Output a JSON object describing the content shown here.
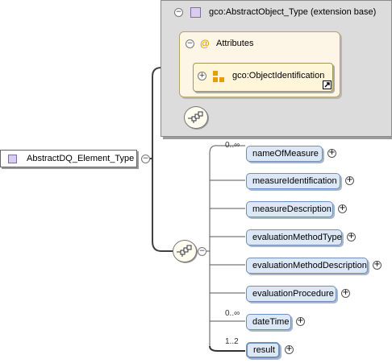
{
  "root": {
    "label": "AbstractDQ_Element_Type",
    "toggle": "−"
  },
  "extension": {
    "title": "gco:AbstractObject_Type (extension base)",
    "toggle": "−",
    "attributes": {
      "label": "Attributes",
      "toggle": "−",
      "group": {
        "label": "gco:ObjectIdentification",
        "toggle": "+"
      }
    }
  },
  "sequence": {
    "toggle": "−",
    "elements": [
      {
        "label": "nameOfMeasure",
        "cardinality": "0..∞"
      },
      {
        "label": "measureIdentification",
        "cardinality": ""
      },
      {
        "label": "measureDescription",
        "cardinality": ""
      },
      {
        "label": "evaluationMethodType",
        "cardinality": ""
      },
      {
        "label": "evaluationMethodDescription",
        "cardinality": ""
      },
      {
        "label": "evaluationProcedure",
        "cardinality": ""
      },
      {
        "label": "dateTime",
        "cardinality": "0..∞"
      },
      {
        "label": "result",
        "cardinality": "1..2"
      }
    ],
    "expand_symbol": "+"
  },
  "colors": {
    "extension_bg": "#dcdcdc",
    "attribute_bg": "#fdf6e6",
    "element_bg": "#dde8f6",
    "element_border": "#6f8fbf",
    "type_icon": "#d9cdec",
    "connector": "#404040"
  },
  "icons": {
    "type": "complex-type-icon",
    "attribute": "attribute-at-icon",
    "group": "attribute-group-icon",
    "sequence": "sequence-compositor-icon",
    "link": "link-arrow-icon"
  }
}
